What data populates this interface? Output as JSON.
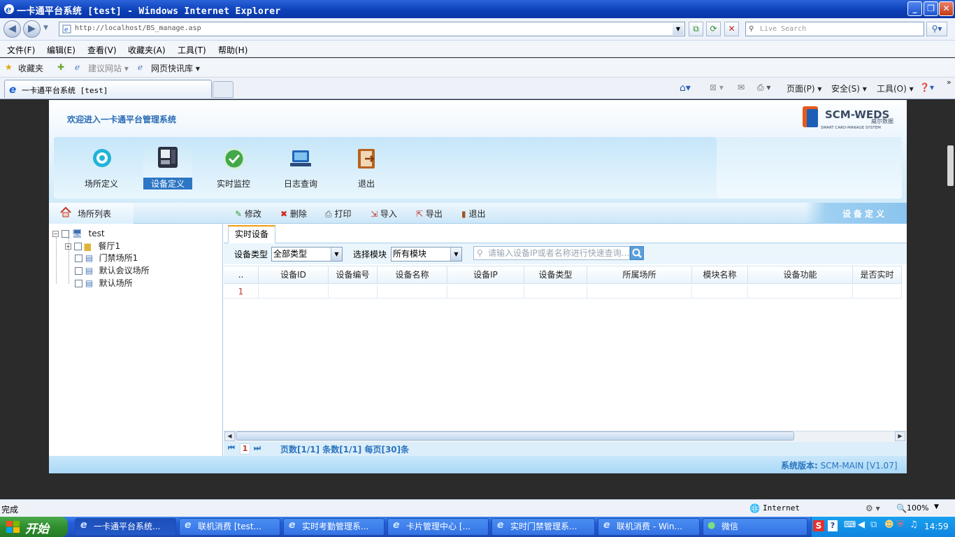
{
  "browser": {
    "window_title": "一卡通平台系统 [test] - Windows Internet Explorer",
    "url": "http://localhost/BS_manage.asp",
    "search_placeholder": "Live Search",
    "menu": [
      "文件(F)",
      "编辑(E)",
      "查看(V)",
      "收藏夹(A)",
      "工具(T)",
      "帮助(H)"
    ],
    "favorites": {
      "label": "收藏夹",
      "suggested": "建议网站 ▾",
      "slices": "网页快讯库 ▾"
    },
    "tab_title": "一卡通平台系统 [test]",
    "commands": {
      "page": "页面(P) ▾",
      "safety": "安全(S) ▾",
      "tools": "工具(O) ▾"
    }
  },
  "app": {
    "welcome": "欢迎进入一卡通平台管理系统",
    "logo_main": "SCM-WEDS",
    "logo_cn": "威尔数据",
    "logo_sub": "SMART CARD-MANAGE SYSTEM",
    "nav": [
      {
        "label": "场所定义",
        "icon": "location-pin-icon"
      },
      {
        "label": "设备定义",
        "icon": "device-terminal-icon",
        "active": true
      },
      {
        "label": "实时监控",
        "icon": "monitor-check-icon"
      },
      {
        "label": "日志查询",
        "icon": "laptop-log-icon"
      },
      {
        "label": "退出",
        "icon": "exit-door-icon"
      }
    ],
    "left_panel": {
      "title": "场所列表",
      "tree": [
        {
          "label": "test",
          "level": 0
        },
        {
          "label": "餐厅1",
          "level": 1
        },
        {
          "label": "门禁场所1",
          "level": 1
        },
        {
          "label": "默认会议场所",
          "level": 1
        },
        {
          "label": "默认场所",
          "level": 1
        }
      ]
    },
    "toolbar": {
      "buttons": [
        "修改",
        "删除",
        "打印",
        "导入",
        "导出",
        "退出"
      ],
      "title": "设备定义"
    },
    "tab": "实时设备",
    "filters": {
      "type_label": "设备类型",
      "type_value": "全部类型",
      "module_label": "选择模块",
      "module_value": "所有模块",
      "search_placeholder": "请输入设备IP或者名称进行快速查询..."
    },
    "grid": {
      "columns": [
        "..",
        "设备ID",
        "设备编号",
        "设备名称",
        "设备IP",
        "设备类型",
        "所属场所",
        "模块名称",
        "设备功能",
        "是否实时"
      ],
      "rows": [
        [
          "1",
          "",
          "",
          "",
          "",
          "",
          "",
          "",
          "",
          ""
        ]
      ]
    },
    "pager": {
      "current": "1",
      "info": "页数[1/1] 条数[1/1] 每页[30]条"
    },
    "footer": {
      "label": "系统版本:",
      "version": "SCM-MAIN [V1.07]"
    }
  },
  "status": {
    "left": "完成",
    "zone": "Internet",
    "zoom": "100%"
  },
  "taskbar": {
    "start": "开始",
    "tasks": [
      "一卡通平台系统...",
      "联机消费 [test...",
      "实时考勤管理系...",
      "卡片管理中心 [...",
      "实时门禁管理系...",
      "联机消费 - Win...",
      "微信"
    ],
    "clock": "14:59"
  },
  "colors": {
    "accent": "#2d76c4",
    "header_bg": "#d2ebf9",
    "tab_indicator": "#f39c12"
  }
}
